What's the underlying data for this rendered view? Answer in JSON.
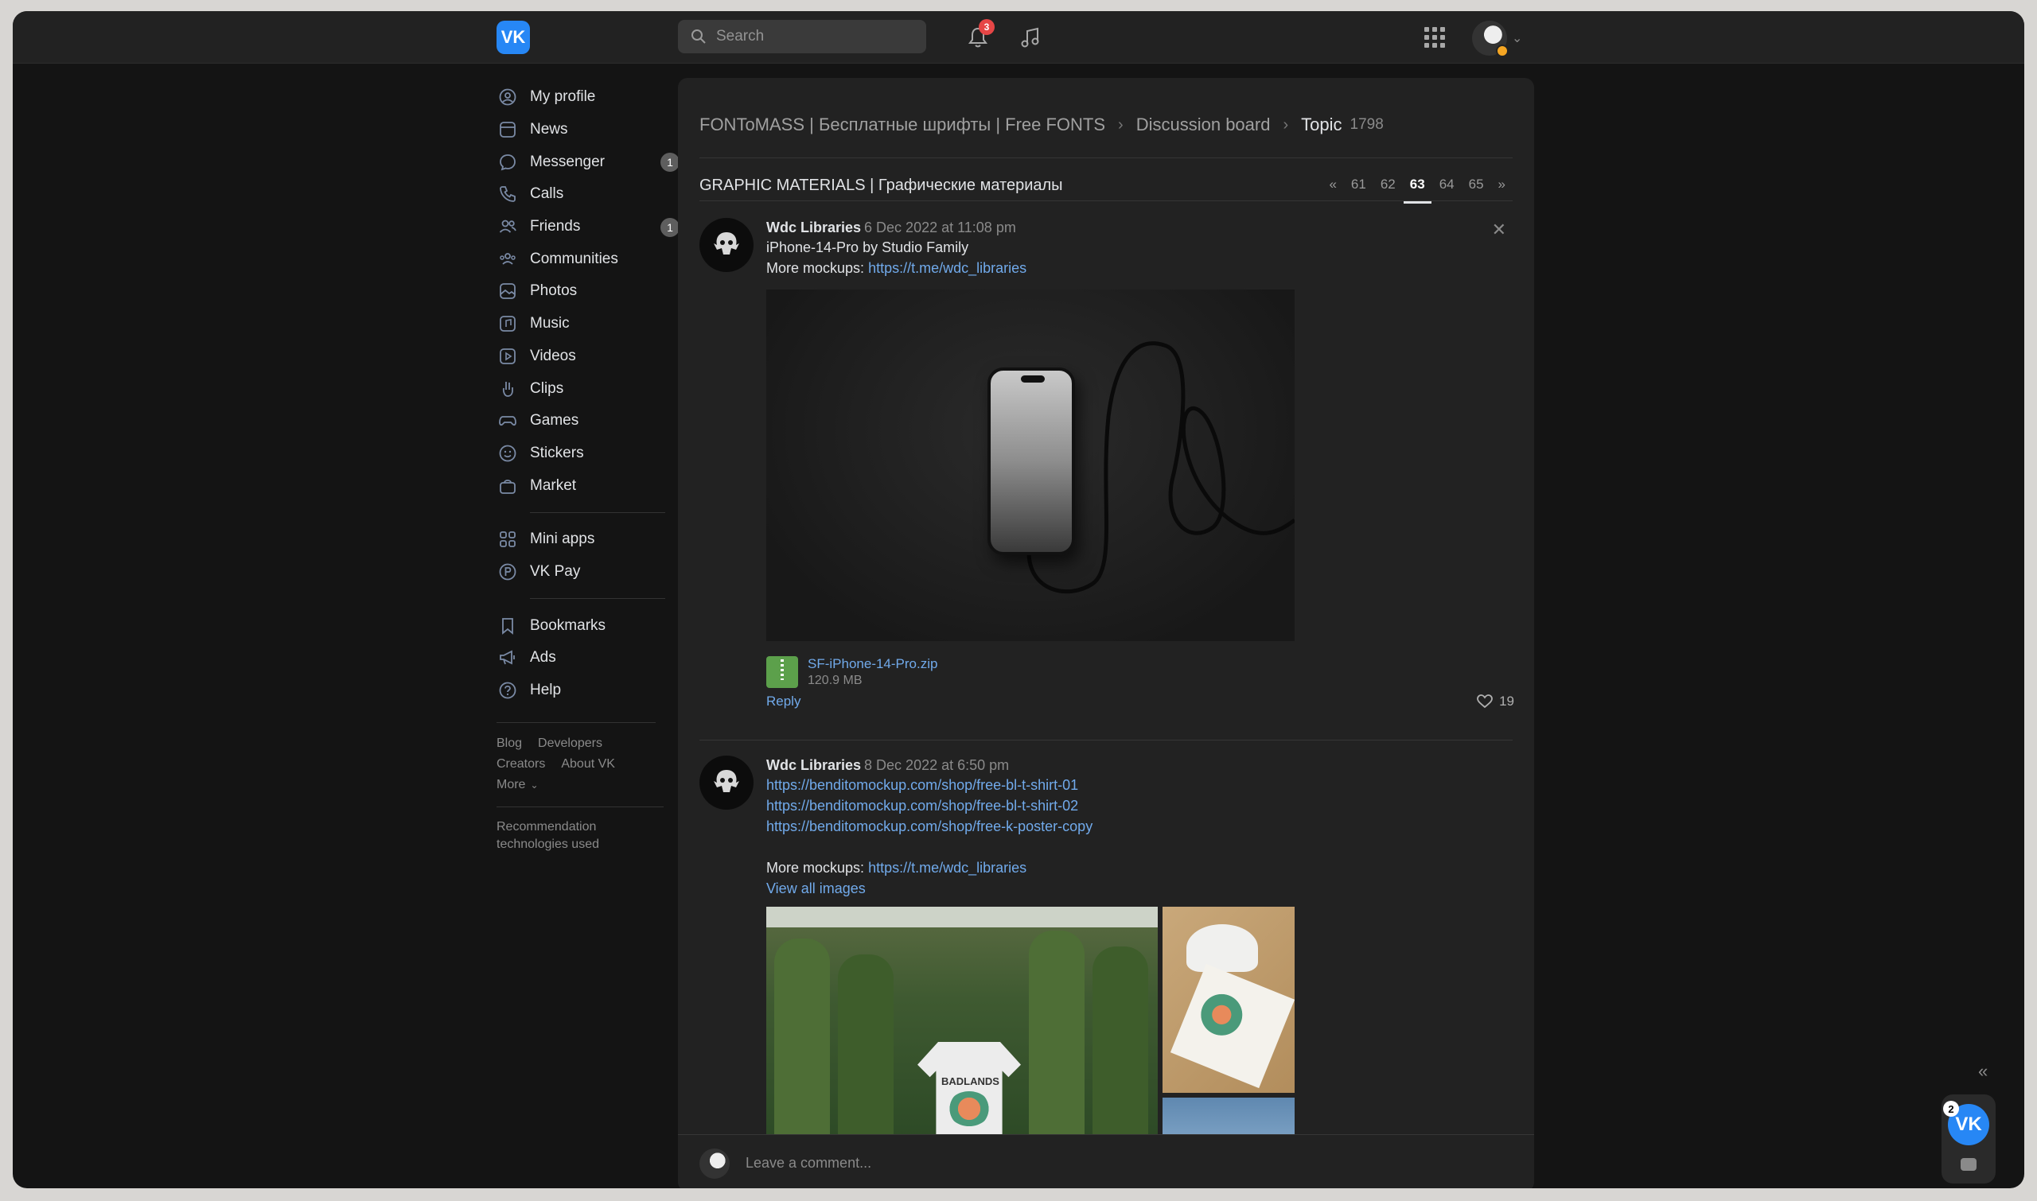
{
  "header": {
    "logo": "VK",
    "search_placeholder": "Search",
    "notifications_count": "3"
  },
  "sidebar": {
    "items": [
      {
        "label": "My profile",
        "icon": "user-circle-icon"
      },
      {
        "label": "News",
        "icon": "news-icon"
      },
      {
        "label": "Messenger",
        "icon": "message-icon",
        "badge": "1"
      },
      {
        "label": "Calls",
        "icon": "phone-icon"
      },
      {
        "label": "Friends",
        "icon": "friends-icon",
        "badge": "1"
      },
      {
        "label": "Communities",
        "icon": "communities-icon"
      },
      {
        "label": "Photos",
        "icon": "photo-icon"
      },
      {
        "label": "Music",
        "icon": "music-icon"
      },
      {
        "label": "Videos",
        "icon": "video-icon"
      },
      {
        "label": "Clips",
        "icon": "clips-icon"
      },
      {
        "label": "Games",
        "icon": "gamepad-icon"
      },
      {
        "label": "Stickers",
        "icon": "smile-icon"
      },
      {
        "label": "Market",
        "icon": "bag-icon"
      }
    ],
    "items2": [
      {
        "label": "Mini apps",
        "icon": "grid-icon"
      },
      {
        "label": "VK Pay",
        "icon": "vkpay-icon"
      }
    ],
    "items3": [
      {
        "label": "Bookmarks",
        "icon": "bookmark-icon"
      },
      {
        "label": "Ads",
        "icon": "megaphone-icon"
      },
      {
        "label": "Help",
        "icon": "help-icon"
      }
    ],
    "footer": {
      "blog": "Blog",
      "developers": "Developers",
      "creators": "Creators",
      "about": "About VK",
      "more": "More"
    },
    "rec_line1": "Recommendation",
    "rec_line2": "technologies used"
  },
  "main": {
    "breadcrumb": {
      "group": "FONToMASS | Бесплатные шрифты | Free FONTS",
      "board": "Discussion board",
      "current": "Topic",
      "count": "1798"
    },
    "topic_title": "GRAPHIC MATERIALS | Графические материалы",
    "pager": {
      "first": "«",
      "pages": [
        "61",
        "62",
        "63",
        "64",
        "65"
      ],
      "active": "63",
      "last": "»"
    },
    "posts": [
      {
        "author": "Wdc Libraries",
        "date": "6 Dec 2022 at 11:08 pm",
        "text1": "iPhone-14-Pro by Studio Family",
        "more_label": "More mockups:",
        "more_link": "https://t.me/wdc_libraries",
        "file_name": "SF-iPhone-14-Pro.zip",
        "file_size": "120.9 MB",
        "reply": "Reply",
        "likes": "19"
      },
      {
        "author": "Wdc Libraries",
        "date": "8 Dec 2022 at 6:50 pm",
        "links": [
          "https://benditomockup.com/shop/free-bl-t-shirt-01",
          "https://benditomockup.com/shop/free-bl-t-shirt-02",
          "https://benditomockup.com/shop/free-k-poster-copy"
        ],
        "more_label": "More mockups:",
        "more_link": "https://t.me/wdc_libraries",
        "view_all": "View all images",
        "shirt_text": "BADLANDS"
      }
    ],
    "comment_placeholder": "Leave a comment..."
  },
  "widget": {
    "badge": "2",
    "logo": "VK"
  }
}
